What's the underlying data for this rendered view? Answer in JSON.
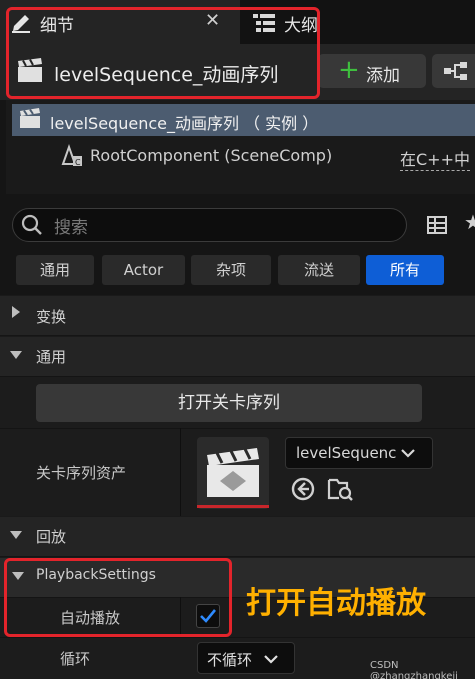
{
  "tabs": [
    {
      "label": "细节",
      "icon": "pencil-icon"
    },
    {
      "label": "大纲",
      "icon": "outline-icon"
    }
  ],
  "header": {
    "actor_name": "levelSequence_动画序列",
    "add_label": "添加"
  },
  "tree": {
    "root_label": "levelSequence_动画序列 （ 实例 ）",
    "child_label": "RootComponent (SceneComp)",
    "child_note": "在C++中"
  },
  "search": {
    "placeholder": "搜索"
  },
  "filters": [
    "通用",
    "Actor",
    "杂项",
    "流送",
    "所有"
  ],
  "sections": {
    "transform": "变换",
    "general": "通用",
    "playback": "回放",
    "playback_settings": "PlaybackSettings"
  },
  "general": {
    "open_button": "打开关卡序列",
    "asset_label": "关卡序列资产",
    "asset_value": "levelSequence"
  },
  "playback": {
    "autoplay_label": "自动播放",
    "autoplay_checked": true,
    "loop_label": "循环",
    "loop_value": "不循环"
  },
  "annotation": "打开自动播放",
  "watermark": "CSDN @zhangzhangkeji",
  "colors": {
    "accent": "#0e5ed6",
    "highlight_box": "#e3242b",
    "annotation": "#ffb000",
    "selected_row": "#4c5c70"
  }
}
